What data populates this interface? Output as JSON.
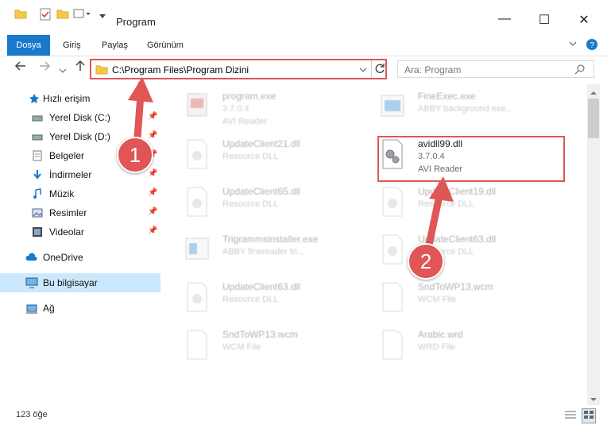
{
  "window": {
    "title": "Program",
    "controls": {
      "minimize": "—",
      "maximize": "☐",
      "close": "✕"
    }
  },
  "ribbon": {
    "tabs": [
      "Dosya",
      "Giriş",
      "Paylaş",
      "Görünüm"
    ],
    "accent": "#1979ca"
  },
  "address": {
    "path": "C:\\Program Files\\Program Dizini",
    "search_placeholder": "Ara: Program"
  },
  "sidebar": {
    "quick_access": "Hızlı erişim",
    "items": [
      {
        "label": "Yerel Disk (C:)",
        "icon": "drive-icon"
      },
      {
        "label": "Yerel Disk (D:)",
        "icon": "drive-icon"
      },
      {
        "label": "Belgeler",
        "icon": "documents-icon"
      },
      {
        "label": "İndirmeler",
        "icon": "downloads-icon"
      },
      {
        "label": "Müzik",
        "icon": "music-icon"
      },
      {
        "label": "Resimler",
        "icon": "pictures-icon"
      },
      {
        "label": "Videolar",
        "icon": "videos-icon"
      }
    ],
    "onedrive": "OneDrive",
    "this_pc": "Bu bilgisayar",
    "network": "Ağ"
  },
  "files": {
    "col1": [
      {
        "name": "program.exe",
        "ver": "3.7.0.4",
        "desc": "AVI Reader"
      },
      {
        "name": "UpdateClient21.dll",
        "ver": "",
        "desc": "Resource DLL"
      },
      {
        "name": "UpdateClient65.dll",
        "ver": "",
        "desc": "Resource DLL"
      },
      {
        "name": "Trigrammsinstaller.exe",
        "ver": "",
        "desc": "ABBY finereader tri..."
      },
      {
        "name": "UpdateClient63.dll",
        "ver": "",
        "desc": "Resource DLL"
      },
      {
        "name": "SndToWP13.wcm",
        "ver": "",
        "desc": "WCM File"
      }
    ],
    "col2": [
      {
        "name": "FineExec.exe",
        "ver": "",
        "desc": "ABBY background exe..."
      },
      {
        "name": "avidll99.dll",
        "ver": "3.7.0.4",
        "desc": "AVI Reader"
      },
      {
        "name": "UpdateClient19.dll",
        "ver": "",
        "desc": "Resource DLL"
      },
      {
        "name": "UpdateClient63.dll",
        "ver": "",
        "desc": "Resource DLL"
      },
      {
        "name": "SndToWP13.wcm",
        "ver": "",
        "desc": "WCM File"
      },
      {
        "name": "Arabic.wrd",
        "ver": "",
        "desc": "WRD File"
      }
    ]
  },
  "status": {
    "count": "123 öğe"
  },
  "annotations": {
    "step1": "1",
    "step2": "2",
    "color": "#e05555"
  }
}
